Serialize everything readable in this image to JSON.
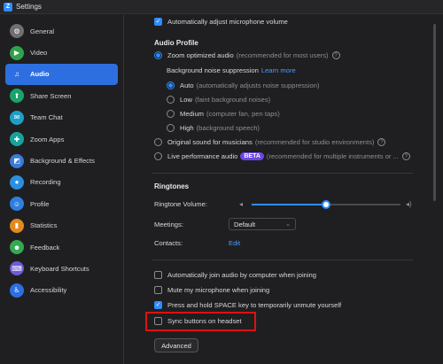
{
  "window": {
    "title": "Settings",
    "app_icon_letter": "Z"
  },
  "sidebar": {
    "items": [
      {
        "label": "General",
        "icon": "gear-icon",
        "glyph": "⚙",
        "color": "#6e6e73",
        "active": false
      },
      {
        "label": "Video",
        "icon": "video-icon",
        "glyph": "▶",
        "color": "#2fa24a",
        "active": false
      },
      {
        "label": "Audio",
        "icon": "headphones-icon",
        "glyph": "♫",
        "color": "#2d6fe0",
        "active": true
      },
      {
        "label": "Share Screen",
        "icon": "share-screen-icon",
        "glyph": "⬆",
        "color": "#1aa36b",
        "active": false
      },
      {
        "label": "Team Chat",
        "icon": "chat-icon",
        "glyph": "✉",
        "color": "#1e9fc7",
        "active": false
      },
      {
        "label": "Zoom Apps",
        "icon": "apps-icon",
        "glyph": "✚",
        "color": "#18a39a",
        "active": false
      },
      {
        "label": "Background & Effects",
        "icon": "background-icon",
        "glyph": "◩",
        "color": "#3a7bd5",
        "active": false
      },
      {
        "label": "Recording",
        "icon": "recording-icon",
        "glyph": "●",
        "color": "#2a8fe0",
        "active": false
      },
      {
        "label": "Profile",
        "icon": "profile-icon",
        "glyph": "☺",
        "color": "#2d7fe0",
        "active": false
      },
      {
        "label": "Statistics",
        "icon": "statistics-icon",
        "glyph": "▮",
        "color": "#e28a1f",
        "active": false
      },
      {
        "label": "Feedback",
        "icon": "feedback-icon",
        "glyph": "☻",
        "color": "#36a852",
        "active": false
      },
      {
        "label": "Keyboard Shortcuts",
        "icon": "keyboard-icon",
        "glyph": "⌨",
        "color": "#6b5cd6",
        "active": false
      },
      {
        "label": "Accessibility",
        "icon": "accessibility-icon",
        "glyph": "♿",
        "color": "#2d6fe0",
        "active": false
      }
    ]
  },
  "audio": {
    "auto_adjust_mic": {
      "label": "Automatically adjust microphone volume",
      "checked": true
    },
    "profile_title": "Audio Profile",
    "zoom_optimized": {
      "label": "Zoom optimized audio",
      "note": "(recommended for most users)",
      "checked": true
    },
    "noise_suppression": {
      "label": "Background noise suppression",
      "link": "Learn more"
    },
    "noise_options": [
      {
        "label": "Auto",
        "note": "(automatically adjusts noise suppression)",
        "checked": true
      },
      {
        "label": "Low",
        "note": "(faint background noises)",
        "checked": false
      },
      {
        "label": "Medium",
        "note": "(computer fan, pen taps)",
        "checked": false
      },
      {
        "label": "High",
        "note": "(background speech)",
        "checked": false
      }
    ],
    "original_sound": {
      "label": "Original sound for musicians",
      "note": "(recommended for studio environments)",
      "checked": false
    },
    "live_performance": {
      "label": "Live performance audio",
      "badge": "BETA",
      "note": "(recommended for multiple instruments or ...",
      "checked": false
    }
  },
  "ringtones": {
    "title": "Ringtones",
    "volume_label": "Ringtone Volume:",
    "volume_level": 0.5,
    "meetings_label": "Meetings:",
    "meetings_value": "Default",
    "contacts_label": "Contacts:",
    "contacts_link": "Edit"
  },
  "options": [
    {
      "label": "Automatically join audio by computer when joining",
      "checked": false
    },
    {
      "label": "Mute my microphone when joining",
      "checked": false
    },
    {
      "label": "Press and hold SPACE key to temporarily unmute yourself",
      "checked": true
    },
    {
      "label": "Sync buttons on headset",
      "checked": false
    }
  ],
  "advanced_button": "Advanced",
  "colors": {
    "accent": "#2d8cff",
    "highlight": "#e01010",
    "beta": "#6b47e5"
  }
}
